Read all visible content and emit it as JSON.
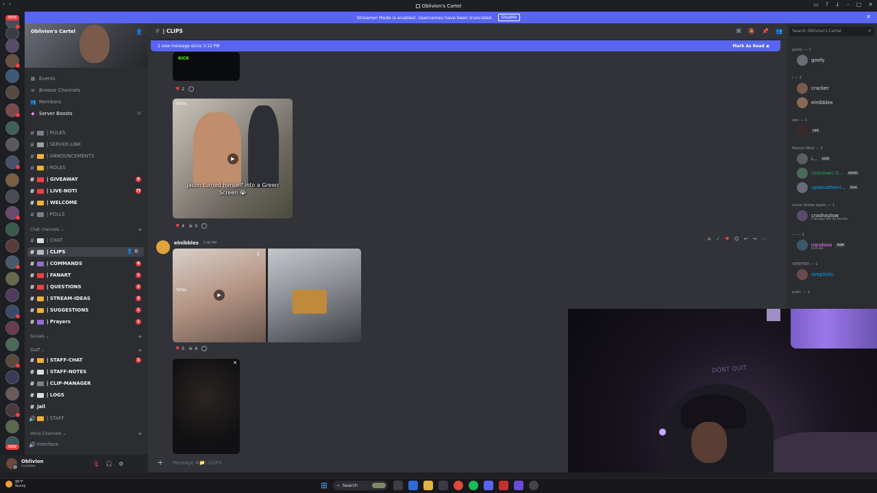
{
  "window": {
    "title": "Oblivion's Cartel"
  },
  "streamer_banner": {
    "text": "Streamer Mode is enabled. Usernames have been truncated.",
    "button": "Disable"
  },
  "guild_bar": {
    "new_label": "NEW"
  },
  "sidebar": {
    "server_name": "Oblivion's Cartel",
    "top_items": [
      {
        "label": "Events",
        "icon": "calendar-icon"
      },
      {
        "label": "Browse Channels",
        "icon": "browse-icon"
      },
      {
        "label": "Members",
        "icon": "members-icon"
      },
      {
        "label": "Server Boosts",
        "icon": "boost-icon"
      }
    ],
    "boost_count": "10",
    "info_channels": [
      {
        "name": "| RULES",
        "color": "#7a7f8a"
      },
      {
        "name": "| SERVER-LINK",
        "color": "#9aa0a6"
      },
      {
        "name": "| ANNOUNCEMENTS",
        "color": "#f0b232"
      },
      {
        "name": "| ROLES",
        "color": "#f0b232"
      },
      {
        "name": "| GIVEAWAY",
        "color": "#f23f43",
        "count": "6",
        "bold": true
      },
      {
        "name": "| LIVE-NOTI",
        "color": "#f23f43",
        "count": "77",
        "bold": true
      },
      {
        "name": "| WELCOME",
        "color": "#f0b232",
        "bold": true
      },
      {
        "name": "| POLLS",
        "color": "#7a7f8a"
      }
    ],
    "chat_category": "Chat channels",
    "chat_channels": [
      {
        "name": "| CHAT",
        "color": "#dbdee1"
      },
      {
        "name": "| CLIPS",
        "color": "#b5bac1",
        "active": true
      },
      {
        "name": "| COMMANDS",
        "color": "#9a6bd6",
        "count": "4",
        "bold": true
      },
      {
        "name": "| FANART",
        "color": "#f23f43",
        "count": "1",
        "bold": true
      },
      {
        "name": "| QUESTIONS",
        "color": "#f23f43",
        "count": "2",
        "bold": true
      },
      {
        "name": "| STREAM-IDEAS",
        "color": "#f0b232",
        "count": "3",
        "bold": true
      },
      {
        "name": "| SUGGESTIONS",
        "color": "#f0b232",
        "count": "1",
        "bold": true
      },
      {
        "name": "| Prayers",
        "color": "#9a6bd6",
        "count": "1",
        "bold": true
      }
    ],
    "socials_category": "Socials",
    "staff_category": "Staff",
    "staff_channels": [
      {
        "name": "| STAFF-CHAT",
        "color": "#f0b232",
        "count": "1",
        "bold": true
      },
      {
        "name": "| STAFF-NOTES",
        "color": "#dbdee1",
        "bold": true
      },
      {
        "name": "| CLIP-MANAGER",
        "color": "#7a7f8a",
        "bold": true
      },
      {
        "name": "| LOGS",
        "color": "#dbdee1",
        "bold": true
      },
      {
        "name": "jail",
        "color": "",
        "bold": true
      },
      {
        "name": "| STAFF",
        "color": "#f0b232",
        "voice": true
      }
    ],
    "voice_category": "Voice Channels",
    "voice_channels": [
      {
        "name": "interface"
      }
    ]
  },
  "user_panel": {
    "name": "Oblivion",
    "status": "Invisible"
  },
  "channel_header": {
    "name": "| CLIPS"
  },
  "new_message_bar": {
    "text": "1 new message since 3:12 PM",
    "action": "Mark As Read"
  },
  "messages": {
    "reactions_1": {
      "heart": "2"
    },
    "clip_1": {
      "caption": "Jason turned himself into a Green Screen 😭",
      "tiktok": "TikTok"
    },
    "reactions_2": {
      "heart": "4",
      "skull": "5"
    },
    "author": "elnibbles",
    "time": "3:08 PM",
    "clip_2": {
      "tiktok": "TikTok"
    },
    "reactions_3": {
      "heart": "5",
      "skull": "6"
    },
    "kick_label": "KICK"
  },
  "composer": {
    "placeholder": "Message #📁| CLIPS"
  },
  "members": {
    "search_placeholder": "Search Oblivion's Cartel",
    "groups": [
      {
        "role": "goofy — 1",
        "members": [
          {
            "name": "goofy",
            "color": "#dbdee1"
          }
        ]
      },
      {
        "role": "i — 2",
        "members": [
          {
            "name": "cracker",
            "color": "#dbdee1"
          },
          {
            "name": "elnibbles",
            "color": "#dbdee1"
          }
        ]
      },
      {
        "role": "zen — 1",
        "members": [
          {
            "name": "",
            "color": "#dbdee1",
            "badge": "Y4R"
          }
        ]
      },
      {
        "role": "Master Mod — 3",
        "members": [
          {
            "name": "i...",
            "color": "#dbdee1",
            "badge": "GOD"
          },
          {
            "name": "Unknown O...",
            "color": "#23a559",
            "badge": "HOOD"
          },
          {
            "name": "upwindtheni...",
            "color": "#00a8fc",
            "badge": "RGA"
          }
        ]
      },
      {
        "role": "never broke again — 1",
        "members": [
          {
            "name": "crashoutsw",
            "color": "#dbdee1",
            "sub": "A Boogie Wit da Hoodie"
          }
        ]
      },
      {
        "role": "— — 1",
        "members": [
          {
            "name": "nandooo",
            "color": "#f47fff",
            "badge": "SDM",
            "sub": "Fortnite"
          }
        ]
      },
      {
        "role": "VERIFIED — 1",
        "members": [
          {
            "name": "simplistic",
            "color": "#00a8fc"
          }
        ]
      },
      {
        "role": "patic — 1",
        "members": []
      }
    ]
  },
  "webcam": {
    "neon_text": "DONT QUIT"
  },
  "taskbar": {
    "temp": "96°F",
    "weather": "Sunny",
    "search": "Search"
  }
}
